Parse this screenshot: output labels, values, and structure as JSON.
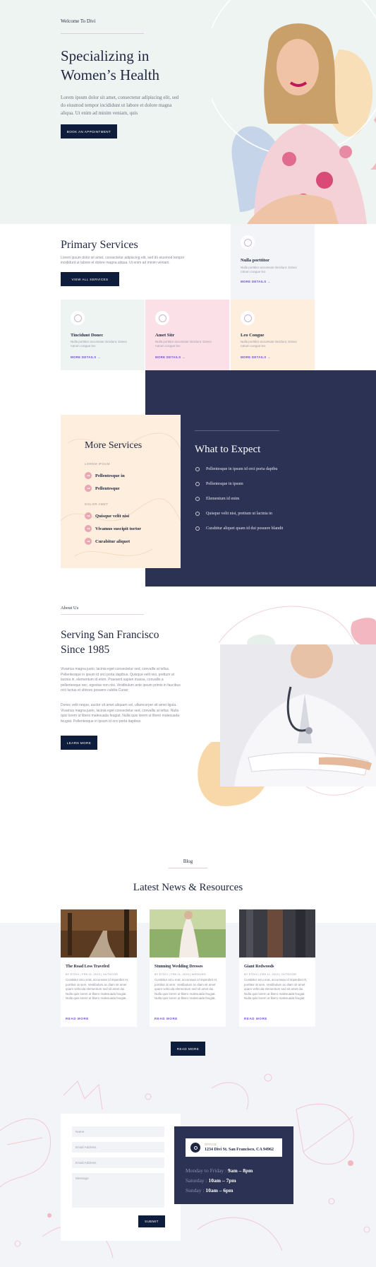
{
  "hero": {
    "eyebrow": "Welcome To Divi",
    "title": "Specializing in Women’s Health",
    "text": "Lorem ipsum dolor sit amet, consectetur adipiscing elit, sed do eiusmod tempor incididunt ut labore et dolore magna aliqua. Ut enim ad minim veniam, quis",
    "button": "Book an Appointment"
  },
  "primary_services": {
    "title": "Primary Services",
    "text": "Lorem ipsum dolor sit amet, consectetur adipiscing elit, sed do eiusmod tempor incididunt ut labore et dolore magna aliqua. Ut enim ad minim veniam.",
    "button": "View All Services",
    "cards": [
      {
        "name": "Nulla porttitor",
        "desc": "Nulla porttitor accumsan tincidunt. Donec rutrum congue leo",
        "link": "MORE DETAILS →",
        "color": "#f2f4f8"
      },
      {
        "name": "Tincidunt Donec",
        "desc": "Nulla porttitor accumsan tincidunt. Donec rutrum congue leo",
        "link": "MORE DETAILS →",
        "color": "#eef4f1"
      },
      {
        "name": "Amet Sitr",
        "desc": "Nulla porttitor accumsan tincidunt. Donec rutrum congue leo",
        "link": "MORE DETAILS →",
        "color": "#fbe1e7"
      },
      {
        "name": "Leo Congue",
        "desc": "Nulla porttitor accumsan tincidunt. Donec rutrum congue leo",
        "link": "MORE DETAILS →",
        "color": "#fdeedd"
      }
    ]
  },
  "more_services": {
    "title": "More Services",
    "cat1": "Lorem Ipsum",
    "items1": [
      "Pellentesque in",
      "Pellentesque"
    ],
    "cat2": "Dolor Amet",
    "items2": [
      "Quisque velit nisi",
      "Vivamus suscipit tortor",
      "Curabitur aliquet"
    ],
    "bullet": "→"
  },
  "expect": {
    "title": "What to Expect",
    "items": [
      "Pellentesque in ipsum id orci porta dapibu",
      "Pellentesque in ipsum",
      "Elementum id enim",
      "Quisque velit nisi, pretium ut lacinia in",
      "Curabitur aliquet quam id dui posuere blandit"
    ]
  },
  "about": {
    "eyebrow": "About Us",
    "title": "Serving San Francisco Since 1985",
    "p1": "Vivamus magna justo, lacinia eget consectetur sed, convallis at tellus. Pellentesque in ipsum id orci porta dapibus. Quisque velit nisi, pretium ut lacinia in, elementum id enim. Praesent sapien massa, convallis a pellentesque nec, egestas non nisi. Vestibulum ante ipsum primis in faucibus orci luctus et ultrices posuere cubilia Curae;",
    "p2": "Donec velit neque, auctor sit amet aliquam vel, ullamcorper sit amet ligula. Vivamus magna justo, lacinia eget consectetur sed, convallis at tellus. Nulla quis lorem ut libero malesuada feugiat. Nulla quis lorem ut libero malesuada feugiat. Pellentesque in ipsum id orci porta dapibus.",
    "button": "Learn More"
  },
  "blog": {
    "eyebrow": "Blog",
    "title": "Latest News & Resources",
    "button": "Read More",
    "posts": [
      {
        "title": "The Road Less Traveled",
        "meta": "BY ETDIV | FEB 11, 2019 | OUTDOOR",
        "excerpt": "Curabitur arcu erat, accumsan id imperdiet et, porttitor at sem. Vestibulum ac diam sit amet quam vehicula elementum sed sit amet dui. Nulla quis lorem ut libero malesuada feugiat. Nulla quis lorem ut libero malesuada feugiat.",
        "read": "READ MORE"
      },
      {
        "title": "Stunning Wedding Dresses",
        "meta": "BY ETDIV | FEB 11, 2019 | WEDDING",
        "excerpt": "Curabitur arcu erat, accumsan id imperdiet et, porttitor at sem. Vestibulum ac diam sit amet quam vehicula elementum sed sit amet dui. Nulla quis lorem ut libero malesuada feugiat. Nulla quis lorem ut libero malesuada feugiat.",
        "read": "READ MORE"
      },
      {
        "title": "Giant Redwoods",
        "meta": "BY ETDIV | FEB 11, 2019 | OUTDOOR",
        "excerpt": "Curabitur arcu erat, accumsan id imperdiet et, porttitor at sem. Vestibulum ac diam sit amet quam vehicula elementum sed sit amet dui. Nulla quis lorem ut libero malesuada feugiat. Nulla quis lorem ut libero malesuada feugiat.",
        "read": "READ MORE"
      }
    ]
  },
  "contact": {
    "name_placeholder": "Name",
    "email_placeholder": "Email Address",
    "email2_placeholder": "Email Address",
    "message_placeholder": "Message",
    "submit": "Submit",
    "office_label": "Office",
    "address": "1234 Divi St. San Francisco, CA 94962",
    "hours": [
      {
        "day": "Monday to Friday : ",
        "time": "9am – 8pm"
      },
      {
        "day": "Saturday : ",
        "time": "10am – 7pm"
      },
      {
        "day": "Sunday : ",
        "time": "10am – 6pm"
      }
    ]
  }
}
